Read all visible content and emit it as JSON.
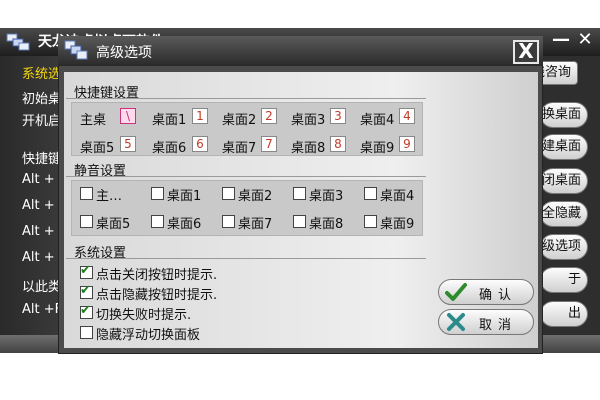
{
  "main_window": {
    "title": "天龙决虚拟桌面软件",
    "controls": {
      "minimize": "—",
      "close": "✕"
    },
    "left_texts": [
      "系统选",
      "初始桌",
      "开机启",
      "快捷键",
      "Alt +",
      "Alt +",
      "Alt +",
      "Alt +",
      "以此类",
      "Alt +F"
    ],
    "right_buttons": [
      "线咨询",
      "换桌面",
      "建桌面",
      "闭桌面",
      "全隐藏",
      "级选项",
      "于",
      "出"
    ]
  },
  "dialog": {
    "title": "高级选项",
    "close_label": "X",
    "hotkey_section": {
      "title": "快捷键设置",
      "items": [
        {
          "label": "主桌",
          "key": "\\"
        },
        {
          "label": "桌面1",
          "key": "1"
        },
        {
          "label": "桌面2",
          "key": "2"
        },
        {
          "label": "桌面3",
          "key": "3"
        },
        {
          "label": "桌面4",
          "key": "4"
        },
        {
          "label": "桌面5",
          "key": "5"
        },
        {
          "label": "桌面6",
          "key": "6"
        },
        {
          "label": "桌面7",
          "key": "7"
        },
        {
          "label": "桌面8",
          "key": "8"
        },
        {
          "label": "桌面9",
          "key": "9"
        }
      ]
    },
    "mute_section": {
      "title": "静音设置",
      "items": [
        {
          "label": "主…",
          "checked": false
        },
        {
          "label": "桌面1",
          "checked": false
        },
        {
          "label": "桌面2",
          "checked": false
        },
        {
          "label": "桌面3",
          "checked": false
        },
        {
          "label": "桌面4",
          "checked": false
        },
        {
          "label": "桌面5",
          "checked": false
        },
        {
          "label": "桌面6",
          "checked": false
        },
        {
          "label": "桌面7",
          "checked": false
        },
        {
          "label": "桌面8",
          "checked": false
        },
        {
          "label": "桌面9",
          "checked": false
        }
      ]
    },
    "system_section": {
      "title": "系统设置",
      "items": [
        {
          "label": "点击关闭按钮时提示.",
          "checked": true
        },
        {
          "label": "点击隐藏按钮时提示.",
          "checked": true
        },
        {
          "label": "切换失败时提示.",
          "checked": true
        },
        {
          "label": "隐藏浮动切换面板",
          "checked": false
        }
      ]
    },
    "buttons": {
      "ok": {
        "label": "确认",
        "icon": "check-icon"
      },
      "cancel": {
        "label": "取消",
        "icon": "cross-icon"
      }
    }
  },
  "colors": {
    "accent_yellow": "#f5d60a",
    "hotkey_red": "#c23b2a",
    "check_green": "#1e7a1e",
    "cancel_teal": "#2b8a8a"
  }
}
